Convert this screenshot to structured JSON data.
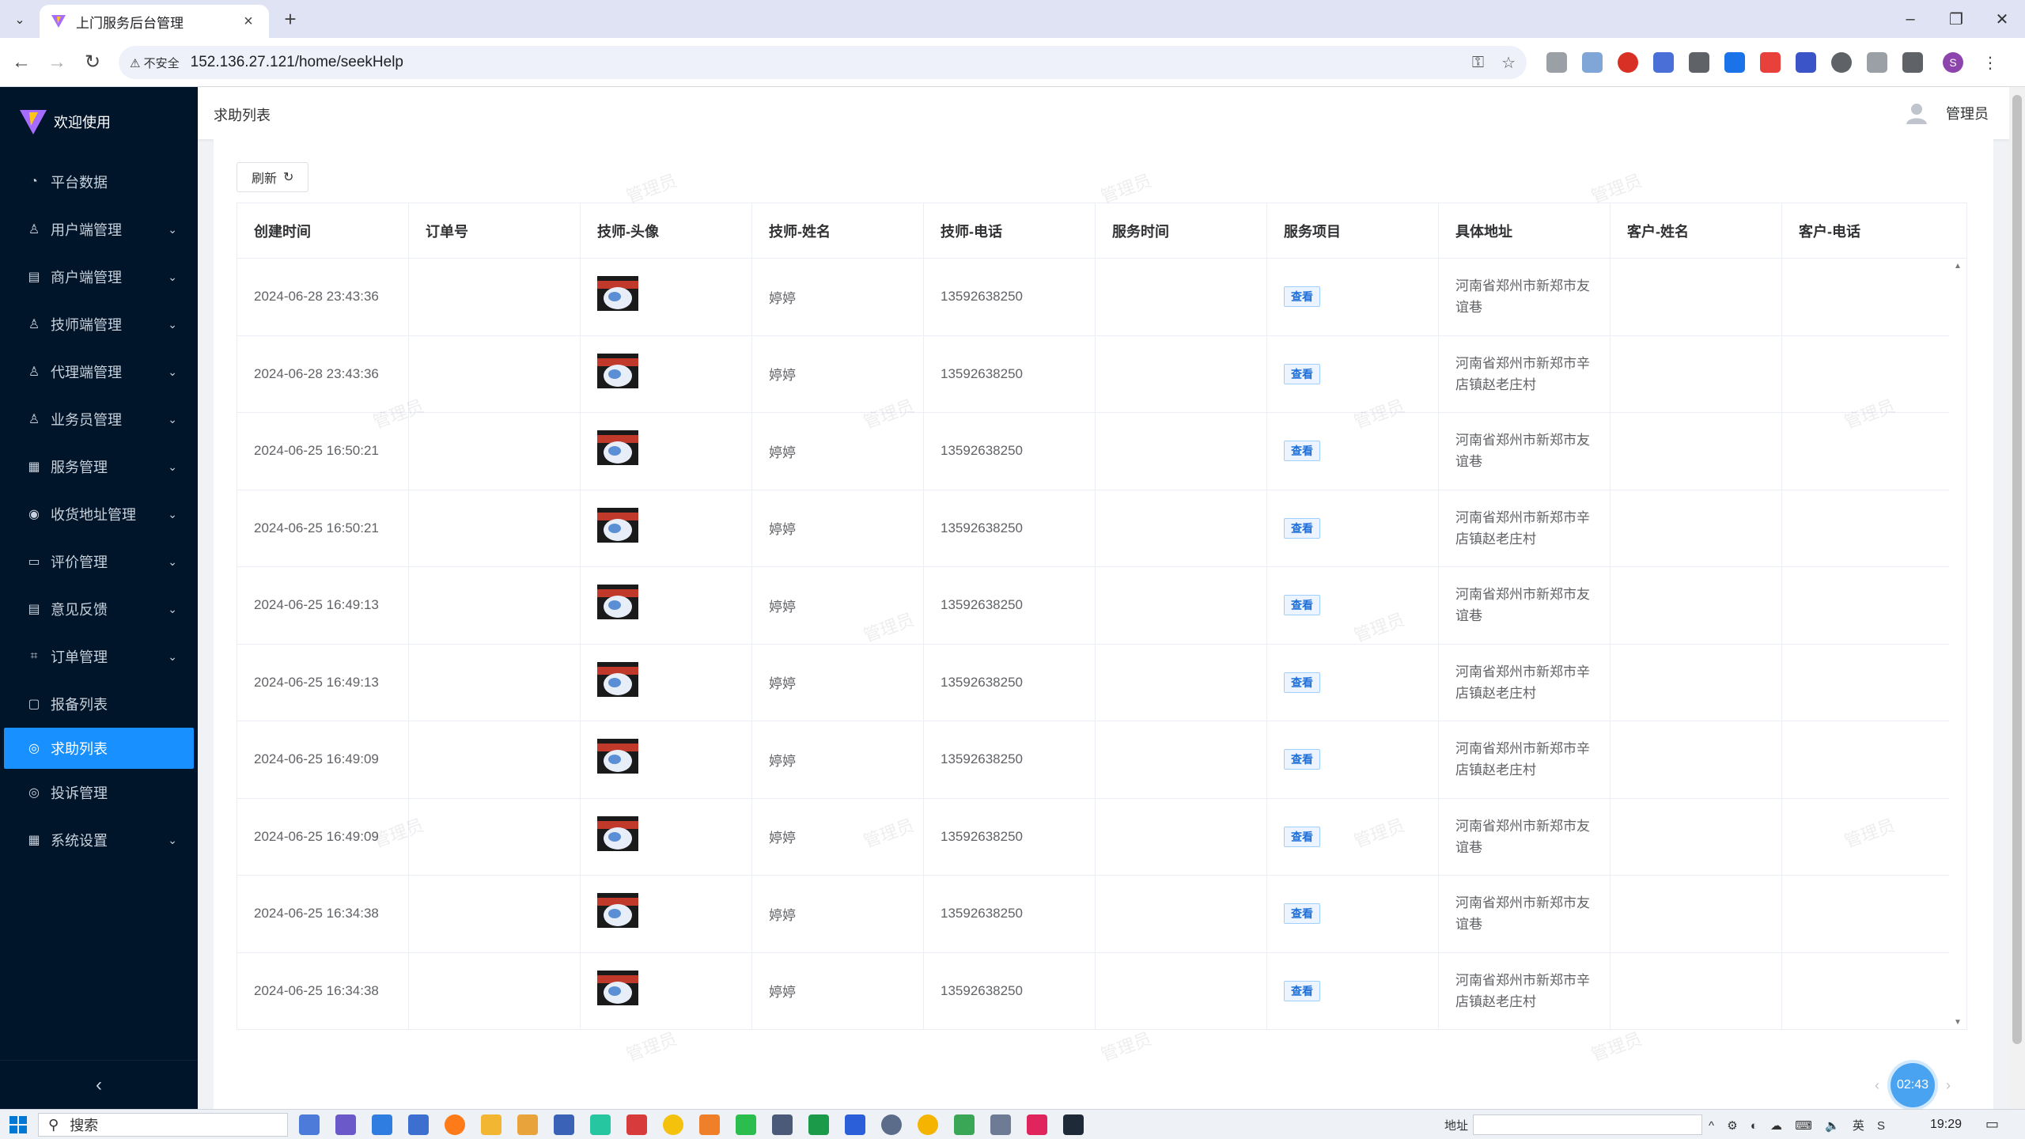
{
  "browser": {
    "tab_title": "上门服务后台管理",
    "tab_close": "×",
    "new_tab": "+",
    "tab_menu": "⌄",
    "insecure_label": "⚠ 不安全",
    "url": "152.136.27.121/home/seekHelp",
    "window_controls": [
      "–",
      "❐",
      "✕"
    ],
    "profile_initial": "S"
  },
  "sidebar": {
    "brand": "欢迎使用",
    "items": [
      {
        "label": "平台数据",
        "icon": "dashboard-icon",
        "glyph": "◔",
        "arrow": ""
      },
      {
        "label": "用户端管理",
        "icon": "user-icon",
        "glyph": "♙",
        "arrow": "⌄"
      },
      {
        "label": "商户端管理",
        "icon": "shop-icon",
        "glyph": "▤",
        "arrow": "⌄"
      },
      {
        "label": "技师端管理",
        "icon": "technician-icon",
        "glyph": "♙",
        "arrow": "⌄"
      },
      {
        "label": "代理端管理",
        "icon": "agent-icon",
        "glyph": "♙",
        "arrow": "⌄"
      },
      {
        "label": "业务员管理",
        "icon": "salesman-icon",
        "glyph": "♙",
        "arrow": "⌄"
      },
      {
        "label": "服务管理",
        "icon": "service-icon",
        "glyph": "▦",
        "arrow": "⌄"
      },
      {
        "label": "收货地址管理",
        "icon": "location-icon",
        "glyph": "◉",
        "arrow": "⌄"
      },
      {
        "label": "评价管理",
        "icon": "review-icon",
        "glyph": "▭",
        "arrow": "⌄"
      },
      {
        "label": "意见反馈",
        "icon": "feedback-icon",
        "glyph": "▤",
        "arrow": "⌄"
      },
      {
        "label": "订单管理",
        "icon": "order-icon",
        "glyph": "⌗",
        "arrow": "⌄"
      },
      {
        "label": "报备列表",
        "icon": "report-icon",
        "glyph": "▢",
        "arrow": ""
      },
      {
        "label": "求助列表",
        "icon": "help-icon",
        "glyph": "◎",
        "arrow": "",
        "active": true
      },
      {
        "label": "投诉管理",
        "icon": "complaint-icon",
        "glyph": "◎",
        "arrow": ""
      },
      {
        "label": "系统设置",
        "icon": "settings-icon",
        "glyph": "▦",
        "arrow": "⌄"
      }
    ],
    "collapse_glyph": "‹"
  },
  "header": {
    "breadcrumb": "求助列表",
    "username": "管理员"
  },
  "toolbar": {
    "refresh_label": "刷新",
    "refresh_glyph": "↻"
  },
  "table": {
    "columns": [
      "创建时间",
      "订单号",
      "技师-头像",
      "技师-姓名",
      "技师-电话",
      "服务时间",
      "服务项目",
      "具体地址",
      "客户-姓名",
      "客户-电话"
    ],
    "view_label": "查看",
    "rows": [
      {
        "created": "2024-06-28 23:43:36",
        "order_no": "",
        "tech_name": "婷婷",
        "tech_phone": "13592638250",
        "service_time": "",
        "address": "河南省郑州市新郑市友谊巷",
        "cust_name": "",
        "cust_phone": ""
      },
      {
        "created": "2024-06-28 23:43:36",
        "order_no": "",
        "tech_name": "婷婷",
        "tech_phone": "13592638250",
        "service_time": "",
        "address": "河南省郑州市新郑市辛店镇赵老庄村",
        "cust_name": "",
        "cust_phone": ""
      },
      {
        "created": "2024-06-25 16:50:21",
        "order_no": "",
        "tech_name": "婷婷",
        "tech_phone": "13592638250",
        "service_time": "",
        "address": "河南省郑州市新郑市友谊巷",
        "cust_name": "",
        "cust_phone": ""
      },
      {
        "created": "2024-06-25 16:50:21",
        "order_no": "",
        "tech_name": "婷婷",
        "tech_phone": "13592638250",
        "service_time": "",
        "address": "河南省郑州市新郑市辛店镇赵老庄村",
        "cust_name": "",
        "cust_phone": ""
      },
      {
        "created": "2024-06-25 16:49:13",
        "order_no": "",
        "tech_name": "婷婷",
        "tech_phone": "13592638250",
        "service_time": "",
        "address": "河南省郑州市新郑市友谊巷",
        "cust_name": "",
        "cust_phone": ""
      },
      {
        "created": "2024-06-25 16:49:13",
        "order_no": "",
        "tech_name": "婷婷",
        "tech_phone": "13592638250",
        "service_time": "",
        "address": "河南省郑州市新郑市辛店镇赵老庄村",
        "cust_name": "",
        "cust_phone": ""
      },
      {
        "created": "2024-06-25 16:49:09",
        "order_no": "",
        "tech_name": "婷婷",
        "tech_phone": "13592638250",
        "service_time": "",
        "address": "河南省郑州市新郑市辛店镇赵老庄村",
        "cust_name": "",
        "cust_phone": ""
      },
      {
        "created": "2024-06-25 16:49:09",
        "order_no": "",
        "tech_name": "婷婷",
        "tech_phone": "13592638250",
        "service_time": "",
        "address": "河南省郑州市新郑市友谊巷",
        "cust_name": "",
        "cust_phone": ""
      },
      {
        "created": "2024-06-25 16:34:38",
        "order_no": "",
        "tech_name": "婷婷",
        "tech_phone": "13592638250",
        "service_time": "",
        "address": "河南省郑州市新郑市友谊巷",
        "cust_name": "",
        "cust_phone": ""
      },
      {
        "created": "2024-06-25 16:34:38",
        "order_no": "",
        "tech_name": "婷婷",
        "tech_phone": "13592638250",
        "service_time": "",
        "address": "河南省郑州市新郑市辛店镇赵老庄村",
        "cust_name": "",
        "cust_phone": ""
      }
    ]
  },
  "watermark_text": "管理员",
  "pager": {
    "prev": "‹",
    "next": "›",
    "timer": "02:43"
  },
  "taskbar": {
    "search_placeholder": "搜索",
    "address_label": "地址",
    "tray": "^ ⚙ ◐ ☁ ⌨ 🔈 英 S",
    "clock": "19:29",
    "notify_glyph": "▭"
  },
  "colors": {
    "sidebar_bg": "#001529",
    "active_menu": "#1890ff",
    "tag_blue": "#1e6fd9"
  }
}
